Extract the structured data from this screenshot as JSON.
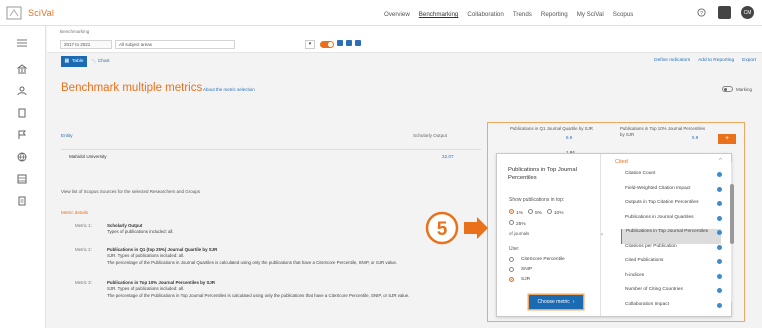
{
  "app": {
    "name": "SciVal"
  },
  "nav": [
    "Overview",
    "Benchmarking",
    "Collaboration",
    "Trends",
    "Reporting",
    "My SciVal",
    "Scopus"
  ],
  "nav_active": "Benchmarking",
  "user_initials": "CM",
  "subbar": {
    "crumb": "Benchmarking",
    "years": "2017 to 2021",
    "filter": "All subject areas"
  },
  "tabs": {
    "table": "Table",
    "chart": "Chart"
  },
  "right_links": [
    "Define Indicators",
    "Add to Reporting",
    "Export"
  ],
  "page_title": "Benchmark multiple metrics",
  "title_link": "About the metric selection",
  "marking_label": "Marking",
  "table": {
    "entity_head": "Entity",
    "metric_head": "Scholarly Output",
    "rows": [
      {
        "entity": "Mahidol University",
        "value": "22.07"
      }
    ]
  },
  "col_heads": [
    {
      "title": "Publications in Q1 Journal Quartile by SJR",
      "value": "5.9"
    },
    {
      "title": "Publications in Top 10% Journal Percentiles by SJR",
      "value": "5.9"
    }
  ],
  "mid_value": "1.84",
  "sources_link": "View list of Scopus Sources for the selected Researchers and Groups",
  "metric_details": {
    "heading": "Metric details",
    "items": [
      {
        "label": "Metric 1:",
        "title": "Scholarly Output",
        "line1": "Types of publications included: all.",
        "line2": ""
      },
      {
        "label": "Metric 2:",
        "title": "Publications in Q1 (top 25%) Journal Quartile by SJR",
        "line1": "SJR. Types of publications included: all.",
        "line2": "The percentage of the Publications in Journal Quartiles is calculated using only the publications that have a CiteScore Percentile, SNIP, or SJR value."
      },
      {
        "label": "Metric 3:",
        "title": "Publications in Top 10% Journal Percentiles by SJR",
        "line1": "SJR. Types of publications included: all.",
        "line2": "The percentage of the Publications in Top Journal Percentiles is calculated using only the publications that have a CiteScore Percentile, SNIP, or SJR value."
      }
    ]
  },
  "chooser": {
    "title": "Publications in Top Journal Percentiles",
    "show_label": "Show publications in top:",
    "options": [
      "1%",
      "5%",
      "10%",
      "25%"
    ],
    "use_label": "Use:",
    "use_options": [
      "CiteScore Percentile",
      "SNIP",
      "SJR"
    ],
    "of_journals": "of journals",
    "button": "Choose metric",
    "list_head": "Cited",
    "metrics": [
      "Citation Count",
      "Field-Weighted Citation Impact",
      "Outputs in Top Citation Percentiles",
      "Publications in Journal Quartiles",
      "Publications in Top Journal Percentiles",
      "Citations per Publication",
      "Cited Publications",
      "h-indices",
      "Number of Citing Countries",
      "Collaboration Impact"
    ],
    "selected_index": 4
  },
  "step_number": "5",
  "colors": {
    "brand": "#e9711c",
    "link": "#2b6fb6",
    "button": "#1b6bb3"
  }
}
